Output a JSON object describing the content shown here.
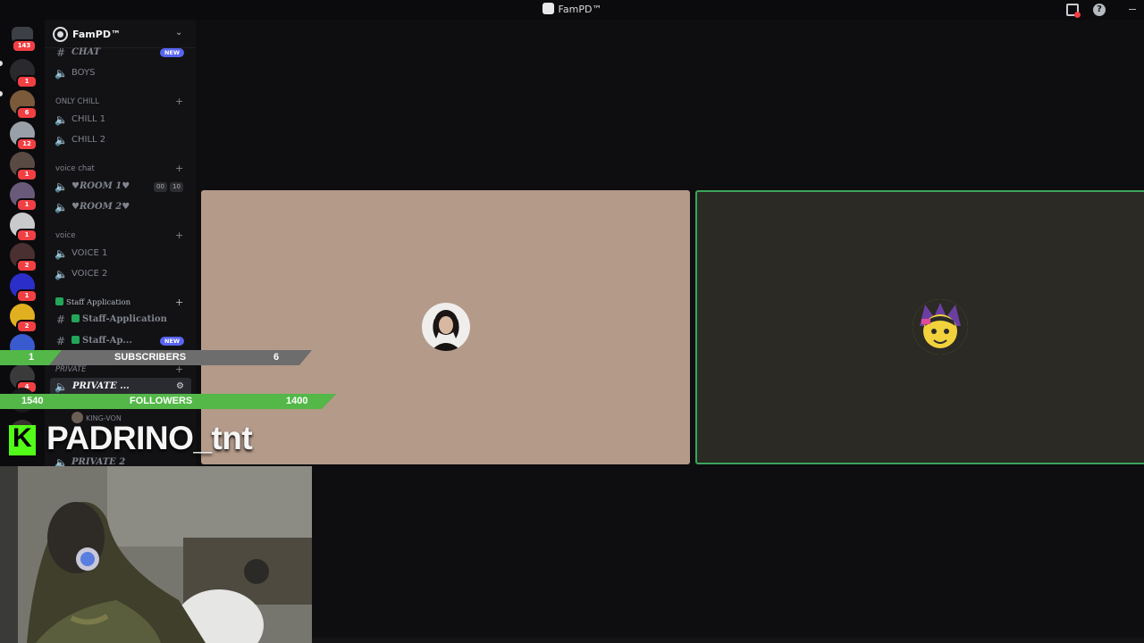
{
  "window": {
    "title": "FamPD™"
  },
  "rail": {
    "home_badge": "143",
    "servers": [
      {
        "name": "server-1",
        "badge": "1",
        "color": "#2a2a2e"
      },
      {
        "name": "server-2",
        "badge": "6",
        "color": "#7a5a3a"
      },
      {
        "name": "server-3",
        "badge": "12",
        "color": "#9aa0a8"
      },
      {
        "name": "server-4",
        "badge": "1",
        "color": "#5a4a44"
      },
      {
        "name": "server-5",
        "badge": "1",
        "color": "#6a5a7a"
      },
      {
        "name": "server-6",
        "badge": "1",
        "color": "#c8cacc"
      },
      {
        "name": "server-7",
        "badge": "2",
        "color": "#4a3030"
      },
      {
        "name": "server-8",
        "badge": "1",
        "color": "#2b2ec8"
      },
      {
        "name": "server-9",
        "badge": "2",
        "color": "#e0b020"
      },
      {
        "name": "server-10",
        "badge": "4",
        "color": "#3a5ad0"
      },
      {
        "name": "server-11",
        "badge": "4",
        "color": "#3a3a3a"
      },
      {
        "name": "server-12",
        "badge": "",
        "color": "#1a1a1a"
      },
      {
        "name": "server-13",
        "badge": "2",
        "color": "#3a3030"
      }
    ]
  },
  "sidebar": {
    "server_name": "FamPD™",
    "new_label": "NEW",
    "channels": {
      "chat": "CHAT",
      "boys": "BOYS",
      "cat_only_chill": "ONLY CHILL",
      "chill1": "CHILL 1",
      "chill2": "CHILL 2",
      "cat_voice_chat": "voice chat",
      "room1": "♥ROOM 1♥",
      "room1_count_a": "00",
      "room1_count_b": "10",
      "room2": "♥ROOM 2♥",
      "cat_voice": "voice",
      "voice1": "VOICE 1",
      "voice2": "VOICE 2",
      "cat_staff": "Staff Application",
      "staff_app": "Staff-Application",
      "staff_ap": "Staff-Ap...",
      "cat_private": "PRIVATE",
      "private1": "PRIVATE ...",
      "user_in_vc": "KING-VON",
      "private2": "PRIVATE 2"
    }
  },
  "overlay": {
    "subs_value_left": "1",
    "subs_label": "SUBSCRIBERS",
    "subs_value_right": "6",
    "subs_progress": 0.166,
    "followers_value_left": "1540",
    "followers_label": "FOLLOWERS",
    "followers_value_right": "1400",
    "followers_progress": 1.0,
    "handle": "PADRINO_tnt",
    "kick_letter": "K"
  },
  "colors": {
    "accent_green": "#53b848",
    "kick_green": "#53fc18",
    "speaking_border": "#3ba55c",
    "badge_red": "#f23f43"
  }
}
